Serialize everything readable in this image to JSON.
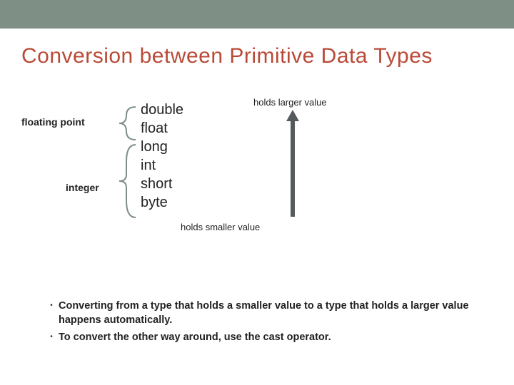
{
  "title": "Conversion between Primitive Data Types",
  "diagram": {
    "fp_label": "floating point",
    "int_label": "integer",
    "types": {
      "t0": "double",
      "t1": "float",
      "t2": "long",
      "t3": "int",
      "t4": "short",
      "t5": "byte"
    },
    "larger_label": "holds larger value",
    "smaller_label": "holds smaller value"
  },
  "bullets": {
    "b1": "Converting from a type that holds a smaller value to a type that holds a larger value happens automatically.",
    "b2": "To convert the other way around, use the cast operator."
  }
}
